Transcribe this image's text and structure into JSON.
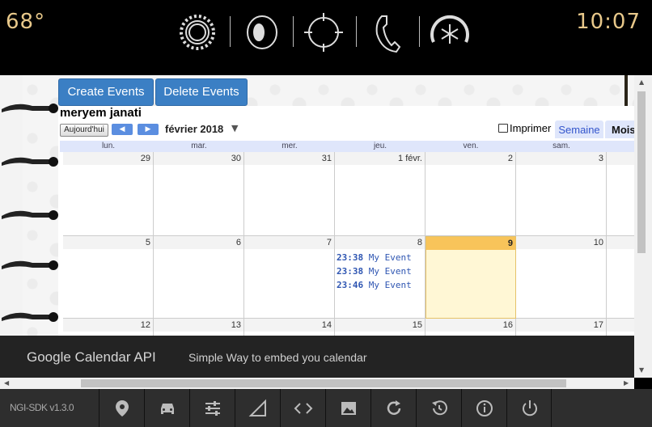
{
  "status_bar": {
    "temperature": "68°",
    "time": "10:07",
    "icons": [
      "settings-gear-icon",
      "media-disc-icon",
      "navigation-crosshair-icon",
      "phone-icon",
      "climate-fan-icon"
    ]
  },
  "toolbar": {
    "create_label": "Create Events",
    "delete_label": "Delete Events"
  },
  "calendar": {
    "title": "meryem janati",
    "today_label": "Aujourd'hui",
    "prev_arrow": "◀",
    "next_arrow": "▶",
    "month_label": "février 2018",
    "print_label": "Imprimer",
    "view_tabs": [
      "Semaine",
      "Mois"
    ],
    "day_names": [
      "lun.",
      "mar.",
      "mer.",
      "jeu.",
      "ven.",
      "sam."
    ],
    "weeks": [
      [
        "29",
        "30",
        "31",
        "1 févr.",
        "2",
        "3"
      ],
      [
        "5",
        "6",
        "7",
        "8",
        "9",
        "10"
      ],
      [
        "12",
        "13",
        "14",
        "15",
        "16",
        "17"
      ]
    ],
    "today_day": "9",
    "events": [
      {
        "time": "23:38",
        "title": "My Event"
      },
      {
        "time": "23:38",
        "title": "My Event"
      },
      {
        "time": "23:46",
        "title": "My Event"
      }
    ],
    "colors": {
      "today_header": "#f8c45a",
      "today_bg": "#fff7d5",
      "event_text": "#2f56b2",
      "button_blue": "#3b7fc4"
    }
  },
  "footer": {
    "title": "Google Calendar API",
    "subtitle": "Simple Way to embed you calendar"
  },
  "bottom_bar": {
    "sdk_version": "NGI-SDK v1.3.0",
    "buttons": [
      "location-pin-icon",
      "car-icon",
      "sliders-icon",
      "signal-icon",
      "code-icon",
      "image-icon",
      "refresh-icon",
      "history-icon",
      "info-icon",
      "power-icon"
    ]
  }
}
